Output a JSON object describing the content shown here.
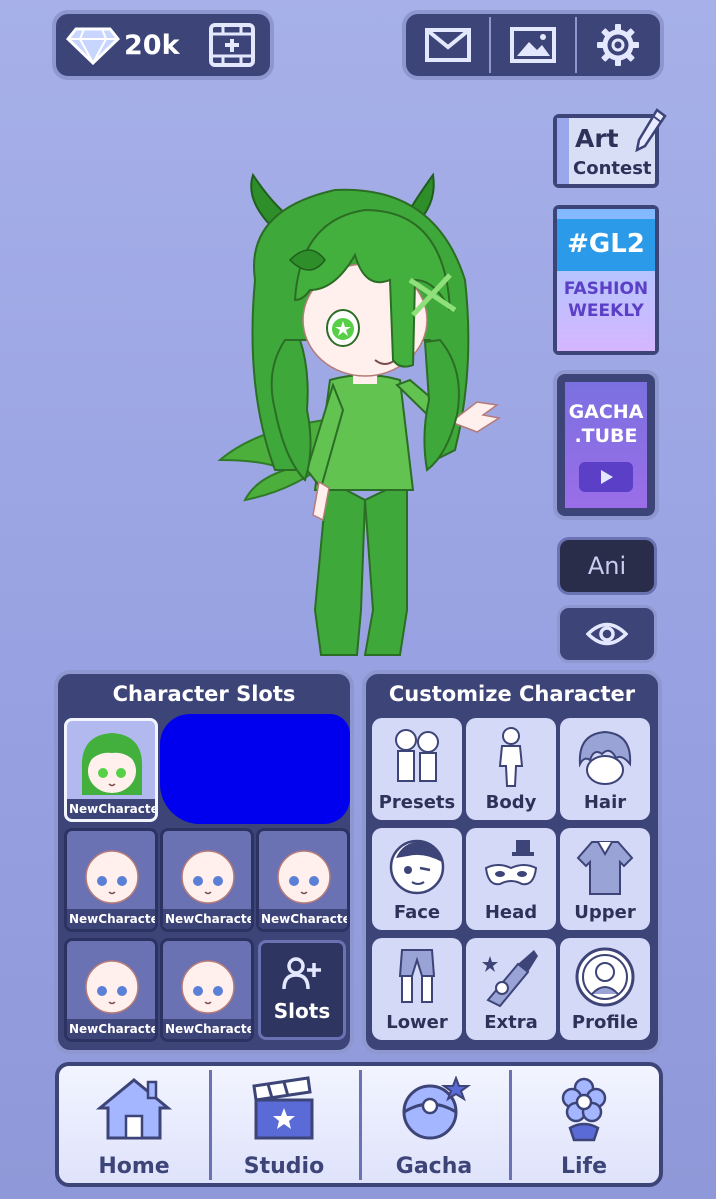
{
  "currency": {
    "amount": "20k",
    "icon": "diamond-icon"
  },
  "top_tools": [
    {
      "name": "mail-icon"
    },
    {
      "name": "image-icon"
    },
    {
      "name": "gear-icon"
    }
  ],
  "side": {
    "art_contest": {
      "line1": "Art",
      "line2": "Contest"
    },
    "gl2": {
      "tag": "#GL2",
      "line1": "FASHION",
      "line2": "WEEKLY"
    },
    "gacha_tube": {
      "line1": "GACHA",
      "line2": ".TUBE"
    },
    "ani_label": "Ani"
  },
  "character_slots": {
    "title": "Character Slots",
    "slots": [
      {
        "label": "NewCharacter"
      },
      {
        "label": "NewCharacter"
      },
      {
        "label": "NewCharacter"
      },
      {
        "label": "NewCharacter"
      },
      {
        "label": "NewCharacter"
      },
      {
        "label": "NewCharacter"
      }
    ],
    "add_label": "Slots"
  },
  "customize": {
    "title": "Customize Character",
    "items": [
      {
        "label": "Presets",
        "icon": "presets-icon"
      },
      {
        "label": "Body",
        "icon": "body-icon"
      },
      {
        "label": "Hair",
        "icon": "hair-icon"
      },
      {
        "label": "Face",
        "icon": "face-icon"
      },
      {
        "label": "Head",
        "icon": "head-icon"
      },
      {
        "label": "Upper",
        "icon": "upper-icon"
      },
      {
        "label": "Lower",
        "icon": "lower-icon"
      },
      {
        "label": "Extra",
        "icon": "extra-icon"
      },
      {
        "label": "Profile",
        "icon": "profile-icon"
      }
    ]
  },
  "nav": [
    {
      "label": "Home",
      "icon": "house-icon"
    },
    {
      "label": "Studio",
      "icon": "clapperboard-icon"
    },
    {
      "label": "Gacha",
      "icon": "gacha-ball-icon"
    },
    {
      "label": "Life",
      "icon": "flower-icon"
    }
  ],
  "colors": {
    "panel": "#3d4478",
    "panel_border": "#8e97d0",
    "background": "#a0a9e5",
    "character_green": "#3fa83a"
  }
}
